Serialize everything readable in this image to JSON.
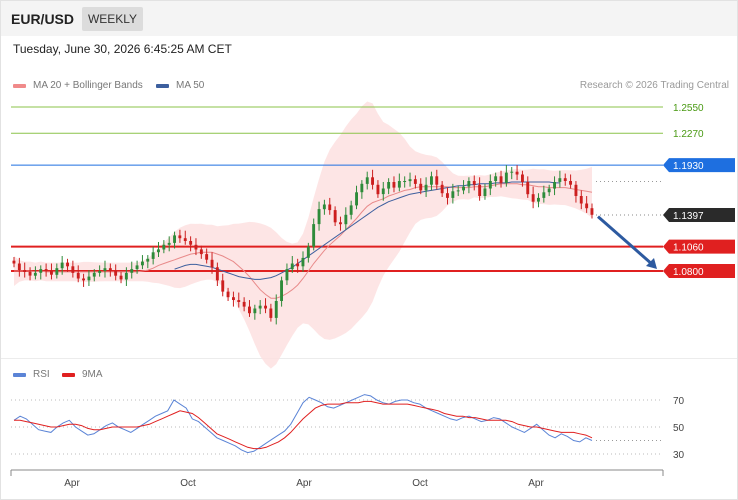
{
  "header": {
    "pair": "EUR/USD",
    "timeframe": "WEEKLY"
  },
  "datetime": "Tuesday, June 30, 2026 6:45:25 AM CET",
  "legend": {
    "ma20": "MA 20 + Bollinger Bands",
    "ma50": "MA 50",
    "credit": "Research © 2026 Trading Central"
  },
  "rsi_legend": {
    "rsi": "RSI",
    "ma9": "9MA"
  },
  "colors": {
    "bull": "#2e8b3a",
    "bear": "#cc1f1f",
    "ma20": "#e88a8a",
    "ma50": "#3d5f9e",
    "band": "#fde0e0",
    "rsi": "#5b84d6",
    "rsi_ma": "#e02020",
    "arrow": "#2d5aa0",
    "resistance": "#1e6fe0",
    "support": "#e02020",
    "target": "#8bc34a"
  },
  "chart_data": [
    {
      "type": "candlestick",
      "title": "EUR/USD",
      "timeframe": "Weekly",
      "x_ticks": [
        "Apr",
        "Oct",
        "Apr",
        "Oct",
        "Apr"
      ],
      "ylim": [
        1.03,
        1.27
      ],
      "levels": [
        {
          "value": 1.255,
          "label": "1.2550",
          "kind": "target"
        },
        {
          "value": 1.227,
          "label": "1.2270",
          "kind": "target"
        },
        {
          "value": 1.193,
          "label": "1.1930",
          "kind": "resistance"
        },
        {
          "value": 1.1397,
          "label": "1.1397",
          "kind": "last"
        },
        {
          "value": 1.106,
          "label": "1.1060",
          "kind": "support"
        },
        {
          "value": 1.08,
          "label": "1.0800",
          "kind": "support"
        }
      ],
      "forecast_arrow": {
        "from": 1.138,
        "to": 1.08
      },
      "close_values": [
        1.088,
        1.081,
        1.079,
        1.075,
        1.078,
        1.082,
        1.08,
        1.076,
        1.083,
        1.089,
        1.085,
        1.078,
        1.072,
        1.07,
        1.074,
        1.078,
        1.08,
        1.083,
        1.08,
        1.075,
        1.071,
        1.078,
        1.082,
        1.086,
        1.09,
        1.093,
        1.1,
        1.103,
        1.108,
        1.11,
        1.118,
        1.115,
        1.112,
        1.108,
        1.103,
        1.098,
        1.092,
        1.084,
        1.07,
        1.058,
        1.052,
        1.049,
        1.047,
        1.042,
        1.035,
        1.04,
        1.043,
        1.04,
        1.03,
        1.048,
        1.07,
        1.082,
        1.088,
        1.085,
        1.094,
        1.106,
        1.13,
        1.146,
        1.151,
        1.145,
        1.132,
        1.13,
        1.14,
        1.15,
        1.164,
        1.173,
        1.18,
        1.172,
        1.162,
        1.168,
        1.175,
        1.169,
        1.176,
        1.176,
        1.178,
        1.173,
        1.166,
        1.172,
        1.181,
        1.172,
        1.163,
        1.158,
        1.165,
        1.166,
        1.17,
        1.176,
        1.172,
        1.16,
        1.168,
        1.176,
        1.181,
        1.174,
        1.185,
        1.186,
        1.183,
        1.175,
        1.162,
        1.154,
        1.158,
        1.164,
        1.168,
        1.175,
        1.179,
        1.176,
        1.172,
        1.16,
        1.152,
        1.147,
        1.14
      ],
      "ma20_values": [
        1.08,
        1.08,
        1.08,
        1.08,
        1.079,
        1.08,
        1.079,
        1.079,
        1.079,
        1.079,
        1.079,
        1.079,
        1.079,
        1.079,
        1.079,
        1.079,
        1.079,
        1.079,
        1.079,
        1.079,
        1.079,
        1.079,
        1.079,
        1.079,
        1.08,
        1.081,
        1.083,
        1.086,
        1.088,
        1.09,
        1.092,
        1.094,
        1.096,
        1.098,
        1.099,
        1.1,
        1.1,
        1.1,
        1.098,
        1.096,
        1.093,
        1.09,
        1.085,
        1.08,
        1.074,
        1.067,
        1.06,
        1.055,
        1.051,
        1.051,
        1.053,
        1.056,
        1.06,
        1.065,
        1.072,
        1.08,
        1.088,
        1.095,
        1.102,
        1.108,
        1.113,
        1.118,
        1.124,
        1.13,
        1.136,
        1.143,
        1.149,
        1.153,
        1.155,
        1.157,
        1.16,
        1.162,
        1.164,
        1.166,
        1.167,
        1.169,
        1.17,
        1.17,
        1.17,
        1.17,
        1.17,
        1.17,
        1.169,
        1.169,
        1.169,
        1.169,
        1.17,
        1.17,
        1.17,
        1.171,
        1.172,
        1.173,
        1.173,
        1.173,
        1.173,
        1.172,
        1.172,
        1.171,
        1.17,
        1.17,
        1.169,
        1.169,
        1.169,
        1.169,
        1.168,
        1.167,
        1.166,
        1.165,
        1.164
      ],
      "ma50_values": [
        null,
        null,
        null,
        null,
        null,
        null,
        null,
        null,
        null,
        null,
        null,
        null,
        null,
        null,
        null,
        null,
        null,
        null,
        null,
        null,
        null,
        null,
        null,
        null,
        null,
        null,
        null,
        null,
        null,
        null,
        1.082,
        1.084,
        1.086,
        1.087,
        1.087,
        1.086,
        1.085,
        1.084,
        1.082,
        1.08,
        1.078,
        1.076,
        1.074,
        1.073,
        1.072,
        1.071,
        1.071,
        1.072,
        1.073,
        1.075,
        1.078,
        1.081,
        1.084,
        1.088,
        1.092,
        1.096,
        1.1,
        1.104,
        1.108,
        1.112,
        1.116,
        1.12,
        1.124,
        1.128,
        1.132,
        1.136,
        1.14,
        1.144,
        1.148,
        1.151,
        1.154,
        1.156,
        1.158,
        1.16,
        1.162,
        1.163,
        1.164,
        1.165,
        1.166,
        1.167,
        1.168,
        1.169,
        1.17,
        1.171,
        1.171,
        1.172,
        1.172,
        1.173,
        1.173,
        1.173,
        1.174,
        1.174,
        1.174,
        1.175,
        1.175,
        1.175,
        1.175,
        1.175,
        1.175,
        1.175,
        1.175,
        1.174,
        1.174
      ]
    },
    {
      "type": "line",
      "title": "RSI",
      "ylim": [
        20,
        80
      ],
      "y_ticks": [
        30,
        50,
        70
      ],
      "series": [
        {
          "name": "RSI",
          "values": [
            55,
            58,
            56,
            52,
            48,
            47,
            46,
            50,
            53,
            55,
            50,
            47,
            44,
            45,
            48,
            51,
            53,
            50,
            48,
            46,
            49,
            52,
            55,
            58,
            60,
            62,
            70,
            67,
            64,
            56,
            54,
            50,
            46,
            42,
            40,
            38,
            36,
            33,
            31,
            32,
            35,
            38,
            41,
            44,
            47,
            52,
            60,
            68,
            72,
            70,
            68,
            65,
            64,
            66,
            68,
            70,
            72,
            74,
            73,
            70,
            68,
            67,
            69,
            70,
            70,
            68,
            67,
            64,
            62,
            60,
            58,
            56,
            55,
            57,
            58,
            56,
            54,
            55,
            57,
            56,
            53,
            50,
            48,
            46,
            49,
            52,
            48,
            44,
            42,
            45,
            43,
            40,
            39,
            42,
            40
          ]
        },
        {
          "name": "9MA",
          "values": [
            55,
            55,
            54,
            53,
            52,
            51,
            50,
            50,
            51,
            52,
            52,
            51,
            49,
            48,
            48,
            49,
            50,
            50,
            50,
            50,
            50,
            51,
            52,
            54,
            56,
            58,
            60,
            62,
            61,
            60,
            57,
            53,
            49,
            45,
            43,
            41,
            39,
            37,
            35,
            34,
            34,
            35,
            37,
            39,
            42,
            46,
            51,
            56,
            60,
            64,
            66,
            67,
            67,
            67,
            68,
            68,
            68,
            69,
            69,
            68,
            67,
            67,
            67,
            67,
            67,
            66,
            65,
            64,
            63,
            62,
            60,
            59,
            58,
            58,
            57,
            57,
            56,
            55,
            55,
            55,
            55,
            54,
            52,
            51,
            50,
            50,
            49,
            48,
            47,
            46,
            46,
            46,
            45,
            44,
            42
          ]
        }
      ]
    }
  ]
}
